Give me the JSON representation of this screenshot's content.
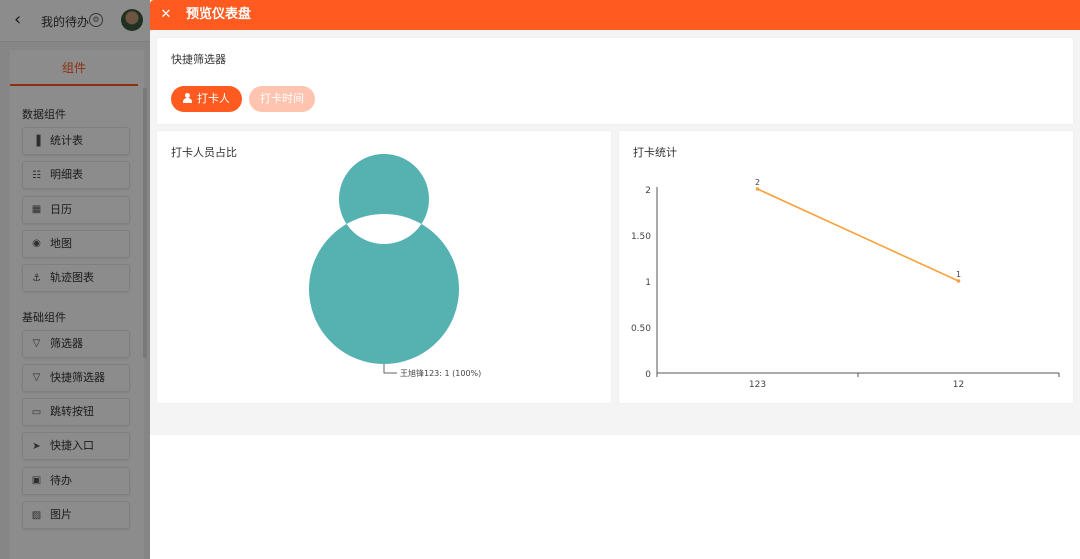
{
  "background": {
    "header": {
      "title": "我的待办"
    },
    "panel": {
      "tab": "组件",
      "sections": [
        {
          "title": "数据组件",
          "items": [
            {
              "label": "统计表",
              "icon": "bar-chart-icon"
            },
            {
              "label": "明细表",
              "icon": "detail-table-icon"
            },
            {
              "label": "日历",
              "icon": "calendar-icon"
            },
            {
              "label": "地图",
              "icon": "map-pin-icon"
            },
            {
              "label": "轨迹图表",
              "icon": "track-icon"
            }
          ]
        },
        {
          "title": "基础组件",
          "items": [
            {
              "label": "筛选器",
              "icon": "filter-icon"
            },
            {
              "label": "快捷筛选器",
              "icon": "quick-filter-icon"
            },
            {
              "label": "跳转按钮",
              "icon": "jump-button-icon"
            },
            {
              "label": "快捷入口",
              "icon": "shortcut-icon"
            },
            {
              "label": "待办",
              "icon": "todo-icon"
            },
            {
              "label": "图片",
              "icon": "image-icon"
            }
          ]
        }
      ]
    }
  },
  "drawer": {
    "title": "预览仪表盘",
    "close_icon": "close-icon",
    "accent_color": "#ff5a1f",
    "filter": {
      "title": "快捷筛选器",
      "buttons": [
        {
          "label": "打卡人",
          "active": true,
          "icon": "person-icon"
        },
        {
          "label": "打卡时间",
          "active": false
        }
      ]
    },
    "pie": {
      "title": "打卡人员占比",
      "legend_label": "王旭锋123: 1 (100%)"
    },
    "line": {
      "title": "打卡统计"
    }
  },
  "chart_data": [
    {
      "type": "pie",
      "title": "打卡人员占比",
      "donut": true,
      "slices": [
        {
          "name": "王旭锋123",
          "value": 1,
          "percent": 100
        }
      ],
      "color": "#55b2b1"
    },
    {
      "type": "line",
      "title": "打卡统计",
      "categories": [
        "123",
        "12"
      ],
      "series": [
        {
          "values": [
            2,
            1
          ]
        }
      ],
      "y_ticks": [
        "0",
        "0.50",
        "1",
        "1.50",
        "2"
      ],
      "ylim": [
        0,
        2
      ],
      "color": "#f7a23c",
      "grid": false
    }
  ]
}
